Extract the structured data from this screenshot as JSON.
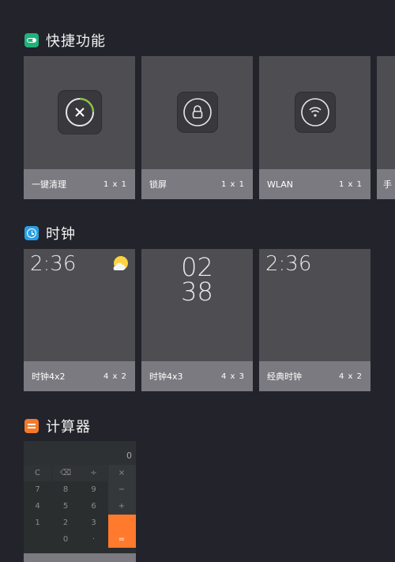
{
  "sections": {
    "quick": {
      "title": "快捷功能",
      "icon": "toggle-icon",
      "color": "#20b27a",
      "cards": [
        {
          "label": "一键清理",
          "size": "1 x 1",
          "icon": "clear-icon"
        },
        {
          "label": "锁屏",
          "size": "1 x 1",
          "icon": "lock-icon"
        },
        {
          "label": "WLAN",
          "size": "1 x 1",
          "icon": "wifi-icon"
        },
        {
          "label": "手",
          "size": ""
        }
      ]
    },
    "clock": {
      "title": "时钟",
      "icon": "clock-icon",
      "color": "#2aa0e3",
      "cards": [
        {
          "label": "时钟4x2",
          "size": "4 x 2",
          "time": "2:36",
          "icon": "sun-cloud-icon"
        },
        {
          "label": "时钟4x3",
          "size": "4 x 3",
          "hour": "02",
          "minute": "38"
        },
        {
          "label": "经典时钟",
          "size": "4 x 2",
          "time": "2:36"
        }
      ]
    },
    "calculator": {
      "title": "计算器",
      "icon": "equals-icon",
      "color": "#f37a2b",
      "display": "0",
      "keys": [
        [
          "C",
          "⌫",
          "÷",
          "×"
        ],
        [
          "7",
          "8",
          "9",
          "−"
        ],
        [
          "4",
          "5",
          "6",
          "+"
        ],
        [
          "1",
          "2",
          "3",
          ""
        ],
        [
          "",
          "0",
          "·",
          "="
        ]
      ],
      "accent": "#ff7a2c"
    }
  }
}
